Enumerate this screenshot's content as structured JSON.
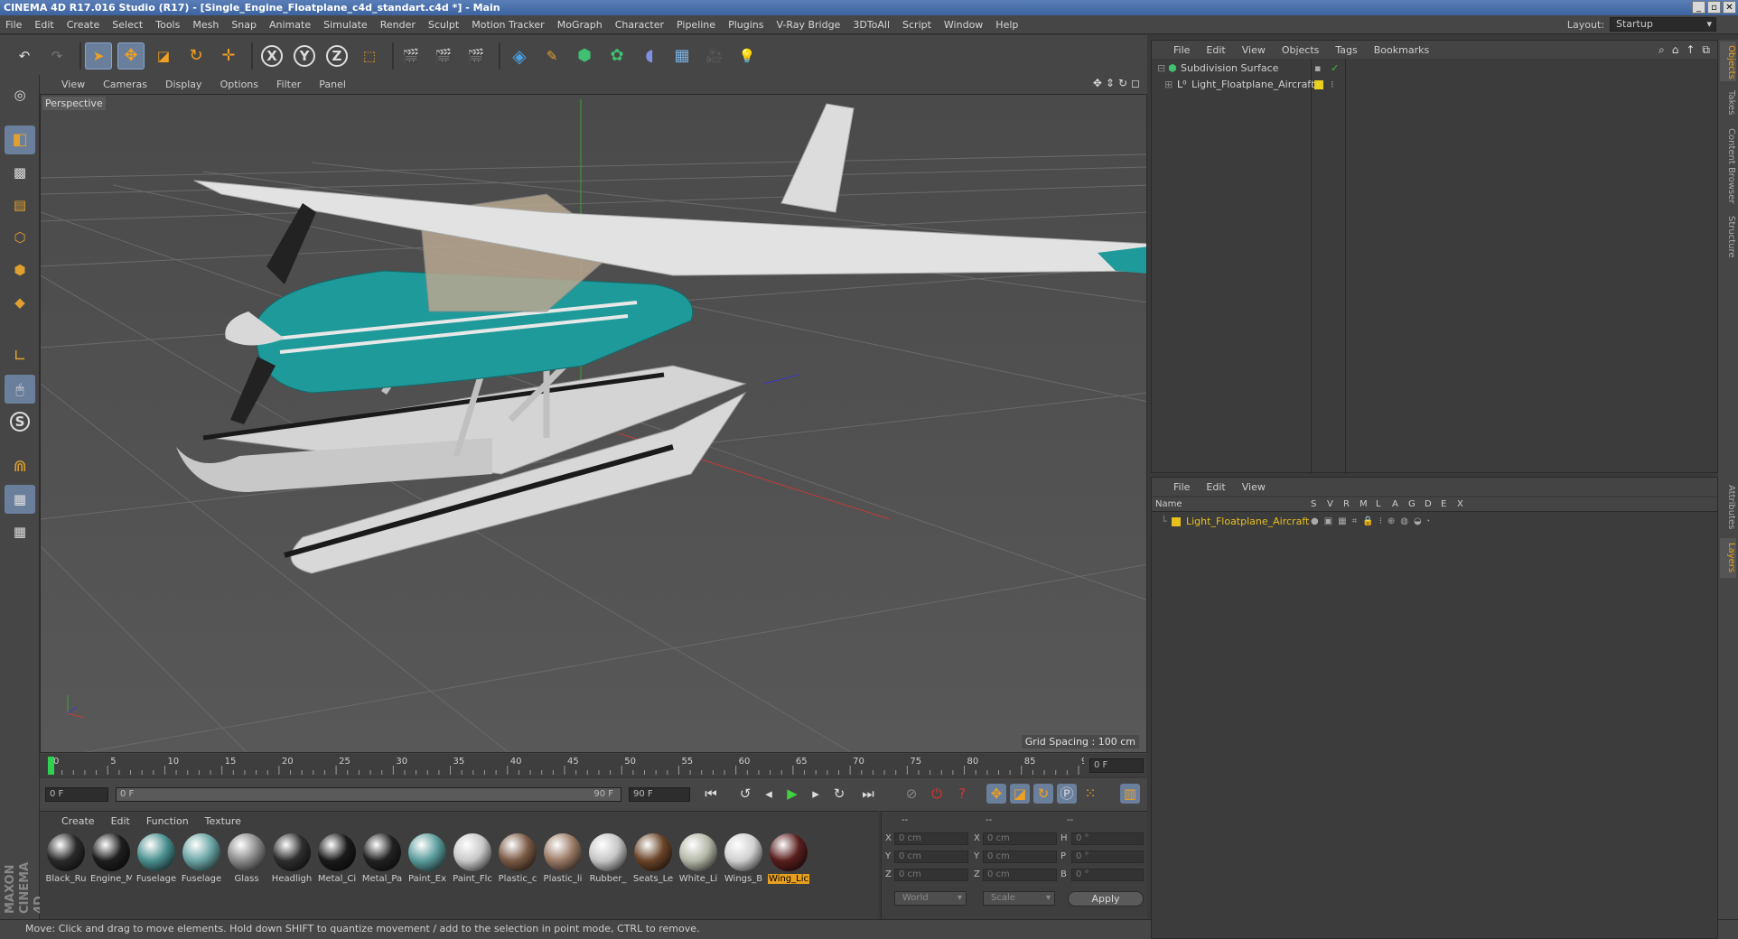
{
  "window": {
    "title": "CINEMA 4D R17.016 Studio (R17) - [Single_Engine_Floatplane_c4d_standart.c4d *] - Main"
  },
  "menubar": {
    "items": [
      "File",
      "Edit",
      "Create",
      "Select",
      "Tools",
      "Mesh",
      "Snap",
      "Animate",
      "Simulate",
      "Render",
      "Sculpt",
      "Motion Tracker",
      "MoGraph",
      "Character",
      "Pipeline",
      "Plugins",
      "V-Ray Bridge",
      "3DToAll",
      "Script",
      "Window",
      "Help"
    ],
    "layout_label": "Layout:",
    "layout_value": "Startup"
  },
  "viewport": {
    "menu": [
      "View",
      "Cameras",
      "Display",
      "Options",
      "Filter",
      "Panel"
    ],
    "camera_label": "Perspective",
    "grid_spacing": "Grid Spacing : 100 cm"
  },
  "timeline": {
    "ticks": [
      "0",
      "5",
      "10",
      "15",
      "20",
      "25",
      "30",
      "35",
      "40",
      "45",
      "50",
      "55",
      "60",
      "65",
      "70",
      "75",
      "80",
      "85",
      "90"
    ],
    "end_frame_field": "0 F",
    "start_field": "0 F",
    "range_start": "0 F",
    "range_end": "90 F",
    "max_field": "90 F"
  },
  "materials": {
    "menu": [
      "Create",
      "Edit",
      "Function",
      "Texture"
    ],
    "items": [
      {
        "name": "Black_Ru",
        "color": "#2a2a2a"
      },
      {
        "name": "Engine_M",
        "color": "#1e1e1e"
      },
      {
        "name": "Fuselage",
        "color": "#4a8f8f"
      },
      {
        "name": "Fuselage",
        "color": "#6aa4a4"
      },
      {
        "name": "Glass",
        "color": "#8a8a8a"
      },
      {
        "name": "Headligh",
        "color": "#2e2e2e"
      },
      {
        "name": "Metal_Ci",
        "color": "#1a1a1a"
      },
      {
        "name": "Metal_Pa",
        "color": "#222222"
      },
      {
        "name": "Paint_Ex",
        "color": "#5a9c9c"
      },
      {
        "name": "Paint_Flc",
        "color": "#c8c8c8"
      },
      {
        "name": "Plastic_c",
        "color": "#7a5a44"
      },
      {
        "name": "Plastic_li",
        "color": "#9a7a66"
      },
      {
        "name": "Rubber_",
        "color": "#c6c6c6"
      },
      {
        "name": "Seats_Le",
        "color": "#6a4428"
      },
      {
        "name": "White_Li",
        "color": "#b4b8a8"
      },
      {
        "name": "Wings_B",
        "color": "#d0d0d0"
      },
      {
        "name": "Wing_Lic",
        "color": "#5a1e1e"
      }
    ]
  },
  "coordinates": {
    "header": [
      "--",
      "--",
      "--"
    ],
    "rows": [
      {
        "a": "X",
        "v1": "0 cm",
        "b": "X",
        "v2": "0 cm",
        "c": "H",
        "v3": "0 °"
      },
      {
        "a": "Y",
        "v1": "0 cm",
        "b": "Y",
        "v2": "0 cm",
        "c": "P",
        "v3": "0 °"
      },
      {
        "a": "Z",
        "v1": "0 cm",
        "b": "Z",
        "v2": "0 cm",
        "c": "B",
        "v3": "0 °"
      }
    ],
    "world": "World",
    "scale": "Scale",
    "apply": "Apply"
  },
  "status": {
    "message": "Move: Click and drag to move elements. Hold down SHIFT to quantize movement / add to the selection in point mode, CTRL to remove."
  },
  "object_manager": {
    "menu": [
      "File",
      "Edit",
      "View",
      "Objects",
      "Tags",
      "Bookmarks"
    ],
    "objects": [
      {
        "name": "Subdivision Surface"
      },
      {
        "name": "Light_Floatplane_Aircraft"
      }
    ]
  },
  "layer_manager": {
    "menu": [
      "File",
      "Edit",
      "View"
    ],
    "columns": [
      "Name",
      "S",
      "V",
      "R",
      "M",
      "L",
      "A",
      "G",
      "D",
      "E",
      "X"
    ],
    "layers": [
      {
        "name": "Light_Floatplane_Aircraft",
        "color": "#e8c01c"
      }
    ]
  },
  "right_tabs": [
    "Objects",
    "Takes",
    "Content Browser",
    "Structure",
    "Attributes",
    "Layers"
  ],
  "logo": {
    "line1": "MAXON",
    "line2": "CINEMA 4D"
  },
  "colors": {
    "accent": "#6a7f9c",
    "highlight": "#e8a01c",
    "plane_teal": "#1e9a9a"
  }
}
